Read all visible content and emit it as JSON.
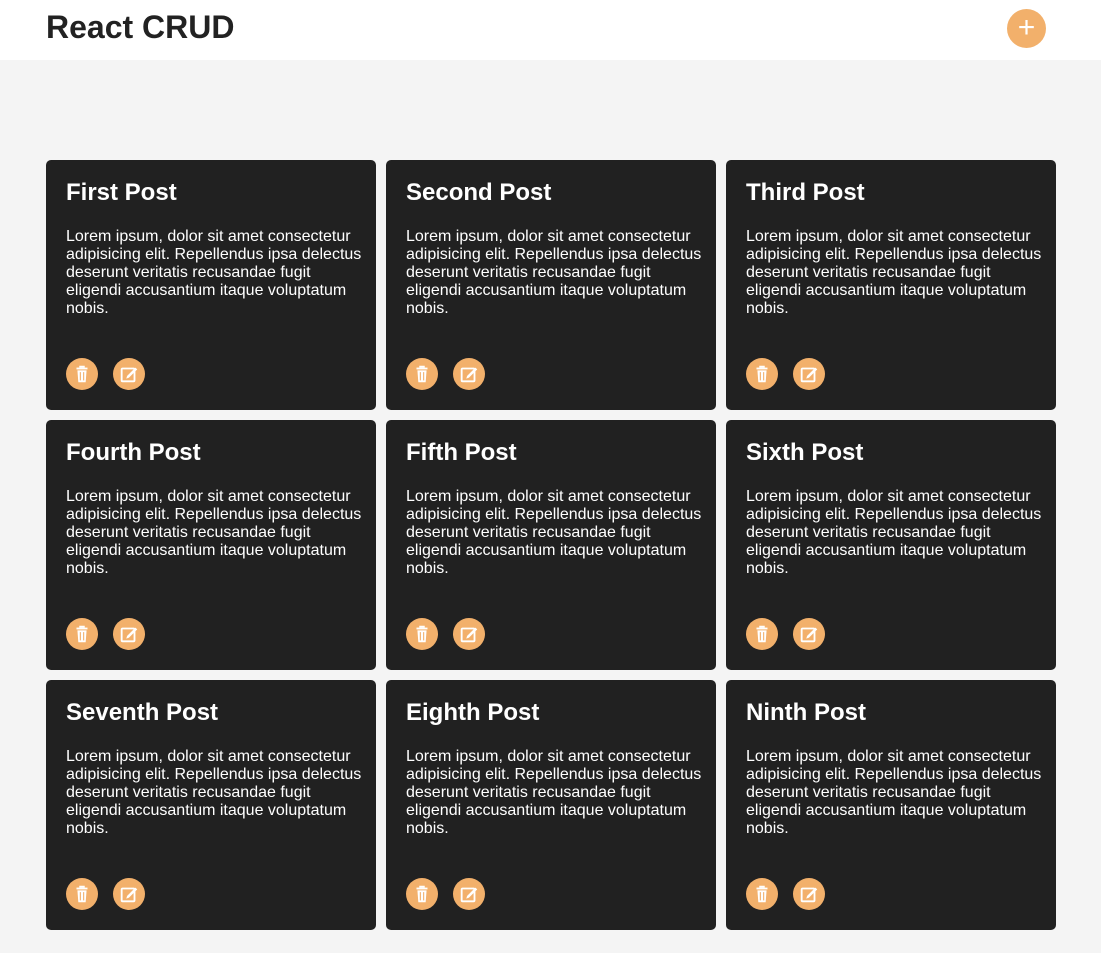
{
  "header": {
    "title": "React CRUD",
    "add_label": "+"
  },
  "accent_color": "#f2b06b",
  "card_color": "#212121",
  "posts": [
    {
      "title": "First Post",
      "body": "Lorem ipsum, dolor sit amet consectetur adipisicing elit. Repellendus ipsa delectus deserunt veritatis recusandae fugit eligendi accusantium itaque voluptatum nobis.",
      "actions": [
        "trash-icon",
        "edit-icon"
      ]
    },
    {
      "title": "Second Post",
      "body": "Lorem ipsum, dolor sit amet consectetur adipisicing elit. Repellendus ipsa delectus deserunt veritatis recusandae fugit eligendi accusantium itaque voluptatum nobis.",
      "actions": [
        "trash-icon",
        "edit-icon"
      ]
    },
    {
      "title": "Third Post",
      "body": "Lorem ipsum, dolor sit amet consectetur adipisicing elit. Repellendus ipsa delectus deserunt veritatis recusandae fugit eligendi accusantium itaque voluptatum nobis.",
      "actions": [
        "trash-icon",
        "edit-icon"
      ]
    },
    {
      "title": "Fourth Post",
      "body": "Lorem ipsum, dolor sit amet consectetur adipisicing elit. Repellendus ipsa delectus deserunt veritatis recusandae fugit eligendi accusantium itaque voluptatum nobis.",
      "actions": [
        "trash-icon",
        "edit-icon"
      ]
    },
    {
      "title": "Fifth Post",
      "body": "Lorem ipsum, dolor sit amet consectetur adipisicing elit. Repellendus ipsa delectus deserunt veritatis recusandae fugit eligendi accusantium itaque voluptatum nobis.",
      "actions": [
        "trash-icon",
        "edit-icon"
      ]
    },
    {
      "title": "Sixth Post",
      "body": "Lorem ipsum, dolor sit amet consectetur adipisicing elit. Repellendus ipsa delectus deserunt veritatis recusandae fugit eligendi accusantium itaque voluptatum nobis.",
      "actions": [
        "trash-icon",
        "edit-icon"
      ]
    },
    {
      "title": "Seventh Post",
      "body": "Lorem ipsum, dolor sit amet consectetur adipisicing elit. Repellendus ipsa delectus deserunt veritatis recusandae fugit eligendi accusantium itaque voluptatum nobis.",
      "actions": [
        "trash-icon",
        "edit-icon"
      ]
    },
    {
      "title": "Eighth Post",
      "body": "Lorem ipsum, dolor sit amet consectetur adipisicing elit. Repellendus ipsa delectus deserunt veritatis recusandae fugit eligendi accusantium itaque voluptatum nobis.",
      "actions": [
        "trash-icon",
        "edit-icon"
      ]
    },
    {
      "title": "Ninth Post",
      "body": "Lorem ipsum, dolor sit amet consectetur adipisicing elit. Repellendus ipsa delectus deserunt veritatis recusandae fugit eligendi accusantium itaque voluptatum nobis.",
      "actions": [
        "trash-icon",
        "edit-icon"
      ]
    }
  ]
}
